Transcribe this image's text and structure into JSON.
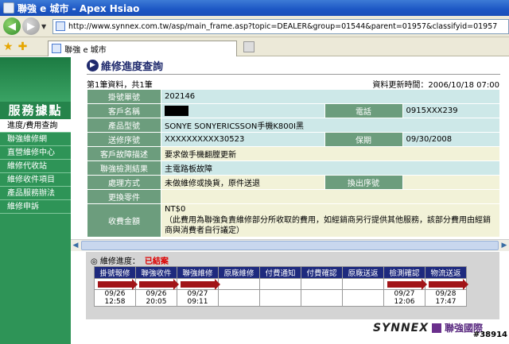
{
  "window": {
    "title": "聯強 e 城市 - Apex Hsiao"
  },
  "address": {
    "url": "http://www.synnex.com.tw/asp/main_frame.asp?topic=DEALER&group=01544&parent=01957&classifyid=01957"
  },
  "tab": {
    "label": "聯強 e 城市"
  },
  "sidebar": {
    "title": "服務據點",
    "items": [
      {
        "label": "進度/費用查詢",
        "active": true
      },
      {
        "label": "聯強維修網"
      },
      {
        "label": "直營維修中心"
      },
      {
        "label": "維修代收站"
      },
      {
        "label": "維修收件項目"
      },
      {
        "label": "產品服務辦法"
      },
      {
        "label": "維修申訴"
      }
    ]
  },
  "main": {
    "title": "維修進度查詢",
    "record_count": "第1筆資料，共1筆",
    "updated": "資料更新時間：2006/10/18 07:00"
  },
  "info": {
    "ticket_label": "掛號單號",
    "ticket_value": "202146",
    "customer_label": "客戶名稱",
    "phone_label": "電話",
    "phone_value": "0915XXX239",
    "model_label": "產品型號",
    "model_value": "SONYE SONYERICSSON手機K800I黑",
    "serial_label": "送修序號",
    "serial_value": "XXXXXXXXXX30523",
    "warranty_label": "保期",
    "warranty_value": "09/30/2008",
    "fault_label": "客戶故障描述",
    "fault_value": "要求做手機翻膛更新",
    "result_label": "聯強檢測結果",
    "result_value": "主電路板故障",
    "method_label": "處理方式",
    "method_value": "未做維修或換貨，原件送退",
    "swap_label": "換出序號",
    "parts_label": "更換零件",
    "fee_label": "收費金額",
    "fee_value": "NT$0",
    "fee_note": "（此費用為聯強負責維修部分所收取的費用，如經銷商另行提供其他服務，該部分費用由經銷商與消費者自行議定）"
  },
  "progress": {
    "label": "◎ 維修進度：",
    "status": "已結案",
    "steps": [
      {
        "label": "掛號報修",
        "done": true,
        "date": "09/26 12:58"
      },
      {
        "label": "聯強收件",
        "done": true,
        "date": "09/26 20:05"
      },
      {
        "label": "聯強維修",
        "done": true,
        "date": "09/27 09:11"
      },
      {
        "label": "原廠維修",
        "done": false,
        "date": ""
      },
      {
        "label": "付費通知",
        "done": false,
        "date": ""
      },
      {
        "label": "付費確認",
        "done": false,
        "date": ""
      },
      {
        "label": "原廠送返",
        "done": false,
        "date": ""
      },
      {
        "label": "檢測確認",
        "done": true,
        "date": "09/27 12:06"
      },
      {
        "label": "物流送返",
        "done": true,
        "date": "09/28 17:47"
      }
    ]
  },
  "footer": {
    "brand_en": "SYNNEX",
    "brand_cn": "聯強國際",
    "watermark": "#38914"
  }
}
